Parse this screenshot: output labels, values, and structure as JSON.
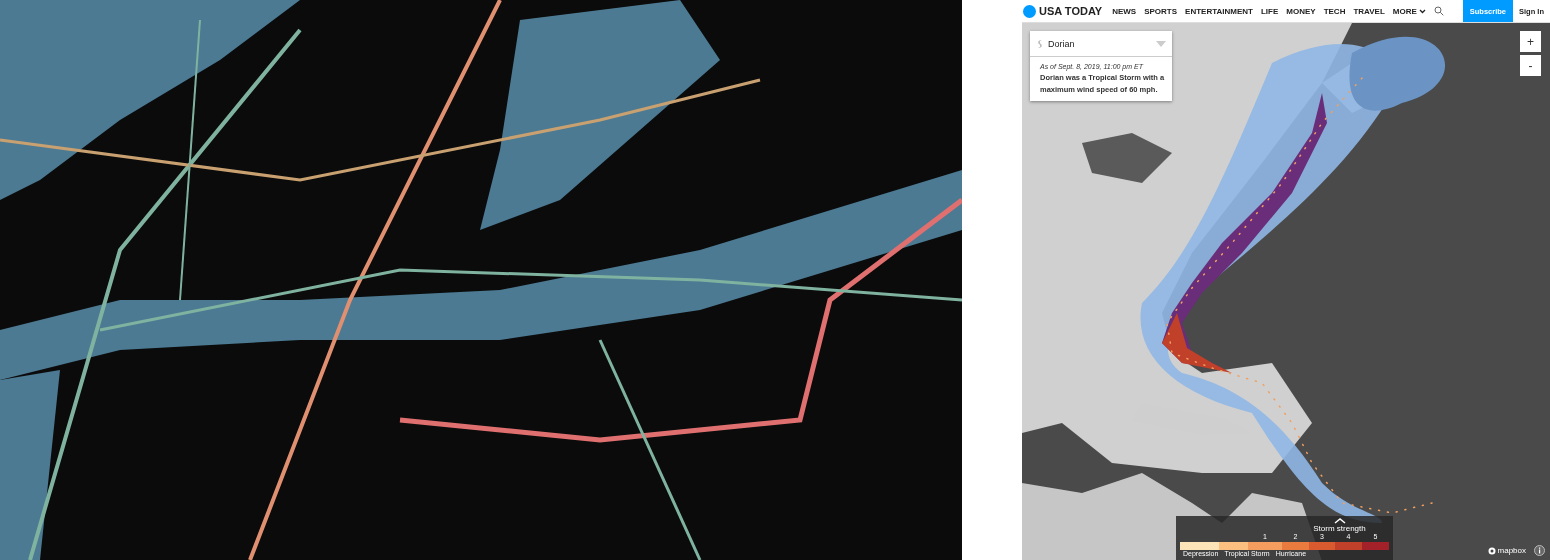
{
  "header": {
    "logo": "USA TODAY",
    "nav": [
      "NEWS",
      "SPORTS",
      "ENTERTAINMENT",
      "LIFE",
      "MONEY",
      "TECH",
      "TRAVEL",
      "MORE"
    ],
    "subscribe": "Subscribe",
    "sign_in": "Sign In"
  },
  "storm_select": {
    "value": "Dorian"
  },
  "info": {
    "date": "As of Sept. 8, 2019, 11:00 pm ET",
    "summary": "Dorian was a Tropical Storm with a maximum wind speed of 60 mph."
  },
  "zoom": {
    "in": "+",
    "out": "-"
  },
  "legend": {
    "toggle": "Storm strength",
    "segments": [
      {
        "color": "#fde3b8"
      },
      {
        "color": "#fbbf7f"
      },
      {
        "color": "#f59d5e",
        "number": "1"
      },
      {
        "color": "#ea7b3f",
        "number": "2"
      },
      {
        "color": "#d85a2e",
        "number": "3"
      },
      {
        "color": "#c0402a",
        "number": "4"
      },
      {
        "color": "#a3222a",
        "number": "5"
      }
    ],
    "labels": [
      "Depression",
      "Tropical Storm",
      "Hurricane"
    ]
  },
  "attribution": "mapbox"
}
